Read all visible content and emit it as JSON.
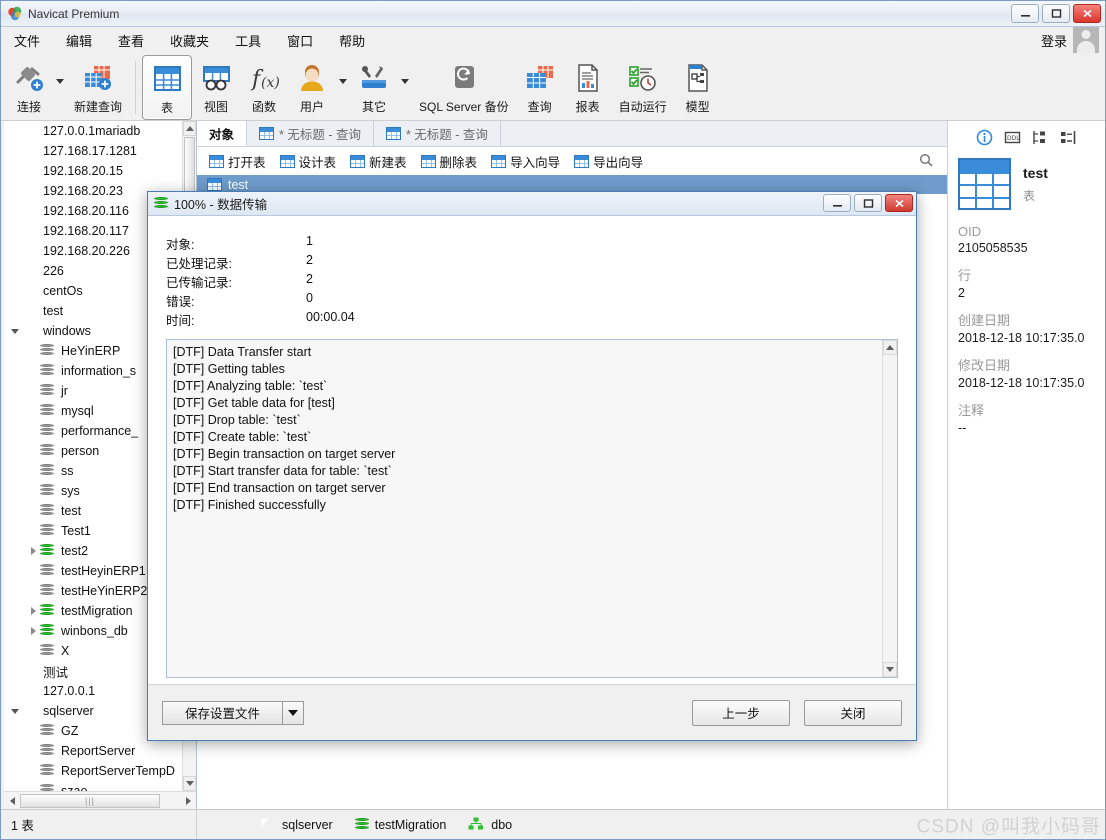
{
  "window": {
    "title": "Navicat Premium",
    "minimize": "—",
    "maximize": "❐",
    "close": "✕"
  },
  "menubar": {
    "items": [
      "文件",
      "编辑",
      "查看",
      "收藏夹",
      "工具",
      "窗口",
      "帮助"
    ],
    "login_label": "登录"
  },
  "ribbon": {
    "items": [
      {
        "label": "连接",
        "icon": "connection-icon",
        "has_caret": true
      },
      {
        "label": "新建查询",
        "icon": "new-query-icon",
        "has_caret": false
      },
      {
        "label": "表",
        "icon": "table-icon",
        "has_caret": false,
        "selected": true
      },
      {
        "label": "视图",
        "icon": "view-icon",
        "has_caret": false
      },
      {
        "label": "函数",
        "icon": "function-icon",
        "has_caret": false
      },
      {
        "label": "用户",
        "icon": "user-icon",
        "has_caret": true
      },
      {
        "label": "其它",
        "icon": "other-tools-icon",
        "has_caret": true
      },
      {
        "label": "SQL Server 备份",
        "icon": "backup-icon",
        "has_caret": false
      },
      {
        "label": "查询",
        "icon": "query-icon",
        "has_caret": false
      },
      {
        "label": "报表",
        "icon": "report-icon",
        "has_caret": false
      },
      {
        "label": "自动运行",
        "icon": "automation-icon",
        "has_caret": false
      },
      {
        "label": "模型",
        "icon": "model-icon",
        "has_caret": false
      }
    ]
  },
  "tree": {
    "nodes": [
      {
        "label": "127.0.0.1mariadb",
        "icon": "connection-icon",
        "level": 0,
        "expander": "none",
        "state": "off"
      },
      {
        "label": "127.168.17.1281",
        "icon": "connection-icon",
        "level": 0,
        "expander": "none",
        "state": "off"
      },
      {
        "label": "192.168.20.15",
        "icon": "connection-icon",
        "level": 0,
        "expander": "none",
        "state": "off"
      },
      {
        "label": "192.168.20.23",
        "icon": "connection-icon",
        "level": 0,
        "expander": "none",
        "state": "off"
      },
      {
        "label": "192.168.20.116",
        "icon": "connection-icon",
        "level": 0,
        "expander": "none",
        "state": "off"
      },
      {
        "label": "192.168.20.117",
        "icon": "connection-icon",
        "level": 0,
        "expander": "none",
        "state": "off"
      },
      {
        "label": "192.168.20.226",
        "icon": "connection-icon",
        "level": 0,
        "expander": "none",
        "state": "off"
      },
      {
        "label": "226",
        "icon": "connection-icon",
        "level": 0,
        "expander": "none",
        "state": "off"
      },
      {
        "label": "centOs",
        "icon": "connection-icon",
        "level": 0,
        "expander": "none",
        "state": "off"
      },
      {
        "label": "test",
        "icon": "connection-icon",
        "level": 0,
        "expander": "none",
        "state": "off"
      },
      {
        "label": "windows",
        "icon": "connection-icon",
        "level": 0,
        "expander": "open",
        "state": "on"
      },
      {
        "label": "HeYinERP",
        "icon": "database-icon",
        "level": 1,
        "expander": "none",
        "state": "off"
      },
      {
        "label": "information_s",
        "icon": "database-icon",
        "level": 1,
        "expander": "none",
        "state": "off"
      },
      {
        "label": "jr",
        "icon": "database-icon",
        "level": 1,
        "expander": "none",
        "state": "off"
      },
      {
        "label": "mysql",
        "icon": "database-icon",
        "level": 1,
        "expander": "none",
        "state": "off"
      },
      {
        "label": "performance_",
        "icon": "database-icon",
        "level": 1,
        "expander": "none",
        "state": "off"
      },
      {
        "label": "person",
        "icon": "database-icon",
        "level": 1,
        "expander": "none",
        "state": "off"
      },
      {
        "label": "ss",
        "icon": "database-icon",
        "level": 1,
        "expander": "none",
        "state": "off"
      },
      {
        "label": "sys",
        "icon": "database-icon",
        "level": 1,
        "expander": "none",
        "state": "off"
      },
      {
        "label": "test",
        "icon": "database-icon",
        "level": 1,
        "expander": "none",
        "state": "off"
      },
      {
        "label": "Test1",
        "icon": "database-icon",
        "level": 1,
        "expander": "none",
        "state": "off"
      },
      {
        "label": "test2",
        "icon": "database-icon",
        "level": 1,
        "expander": "closed",
        "state": "on"
      },
      {
        "label": "testHeyinERP1",
        "icon": "database-icon",
        "level": 1,
        "expander": "none",
        "state": "off"
      },
      {
        "label": "testHeYinERP2",
        "icon": "database-icon",
        "level": 1,
        "expander": "none",
        "state": "off"
      },
      {
        "label": "testMigration",
        "icon": "database-icon",
        "level": 1,
        "expander": "closed",
        "state": "on"
      },
      {
        "label": "winbons_db",
        "icon": "database-icon",
        "level": 1,
        "expander": "closed",
        "state": "on"
      },
      {
        "label": "X",
        "icon": "database-icon",
        "level": 1,
        "expander": "none",
        "state": "off"
      },
      {
        "label": "测试",
        "icon": "connection-icon",
        "level": 0,
        "expander": "none",
        "state": "off"
      },
      {
        "label": "127.0.0.1",
        "icon": "sqlserver-icon",
        "level": 0,
        "expander": "none",
        "state": "off"
      },
      {
        "label": "sqlserver",
        "icon": "sqlserver-icon",
        "level": 0,
        "expander": "open",
        "state": "on"
      },
      {
        "label": "GZ",
        "icon": "database-icon",
        "level": 1,
        "expander": "none",
        "state": "off"
      },
      {
        "label": "ReportServer",
        "icon": "database-icon",
        "level": 1,
        "expander": "none",
        "state": "off"
      },
      {
        "label": "ReportServerTempD",
        "icon": "database-icon",
        "level": 1,
        "expander": "none",
        "state": "off"
      },
      {
        "label": "szao",
        "icon": "database-icon",
        "level": 1,
        "expander": "none",
        "state": "off"
      }
    ]
  },
  "center": {
    "tabs": [
      {
        "label": "对象",
        "active": true,
        "icon": "none"
      },
      {
        "label": "* 无标题 - 查询",
        "active": false,
        "icon": "query-tab-icon"
      },
      {
        "label": "* 无标题 - 查询",
        "active": false,
        "icon": "query-tab-icon"
      }
    ],
    "toolbar": [
      {
        "label": "打开表",
        "icon": "open-table-icon"
      },
      {
        "label": "设计表",
        "icon": "design-table-icon"
      },
      {
        "label": "新建表",
        "icon": "new-table-icon"
      },
      {
        "label": "删除表",
        "icon": "delete-table-icon"
      },
      {
        "label": "导入向导",
        "icon": "import-wizard-icon"
      },
      {
        "label": "导出向导",
        "icon": "export-wizard-icon"
      }
    ],
    "rows": [
      {
        "label": "test",
        "icon": "table-icon",
        "selected": true
      }
    ]
  },
  "info_panel": {
    "icons": [
      "info-icon",
      "ddl-icon",
      "tree-view-icon",
      "compare-icon"
    ],
    "object_name": "test",
    "object_type": "表",
    "fields": [
      {
        "key": "OID",
        "value": "2105058535"
      },
      {
        "key": "行",
        "value": "2"
      },
      {
        "key": "创建日期",
        "value": "2018-12-18 10:17:35.0"
      },
      {
        "key": "修改日期",
        "value": "2018-12-18 10:17:35.0"
      },
      {
        "key": "注释",
        "value": "--"
      }
    ]
  },
  "statusbar": {
    "left_text": "1 表",
    "items": [
      {
        "label": "sqlserver",
        "icon": "sqlserver-icon"
      },
      {
        "label": "testMigration",
        "icon": "database-icon"
      },
      {
        "label": "dbo",
        "icon": "schema-icon"
      }
    ],
    "watermark": "CSDN @叫我小码哥"
  },
  "dialog": {
    "title": "100% - 数据传输",
    "minimize": "—",
    "maximize": "❐",
    "close": "✕",
    "stats": [
      {
        "key": "对象:",
        "value": "1"
      },
      {
        "key": "已处理记录:",
        "value": "2"
      },
      {
        "key": "已传输记录:",
        "value": "2"
      },
      {
        "key": "错误:",
        "value": "0"
      },
      {
        "key": "时间:",
        "value": "00:00.04"
      }
    ],
    "log_lines": [
      "[DTF] Data Transfer start",
      "[DTF] Getting tables",
      "[DTF] Analyzing table: `test`",
      "[DTF] Get table data for [test]",
      "[DTF] Drop table: `test`",
      "[DTF] Create table: `test`",
      "[DTF] Begin transaction on target server",
      "[DTF] Start transfer data for table: `test`",
      "[DTF] End transaction on target server",
      "[DTF] Finished successfully"
    ],
    "save_button": "保存设置文件",
    "back_button": "上一步",
    "close_button": "关闭"
  },
  "colors": {
    "accent": "#3a8cd8",
    "selection": "#6f9ccb",
    "green": "#2fbf2f",
    "orange": "#f5a623",
    "close_red": "#d9352c"
  }
}
